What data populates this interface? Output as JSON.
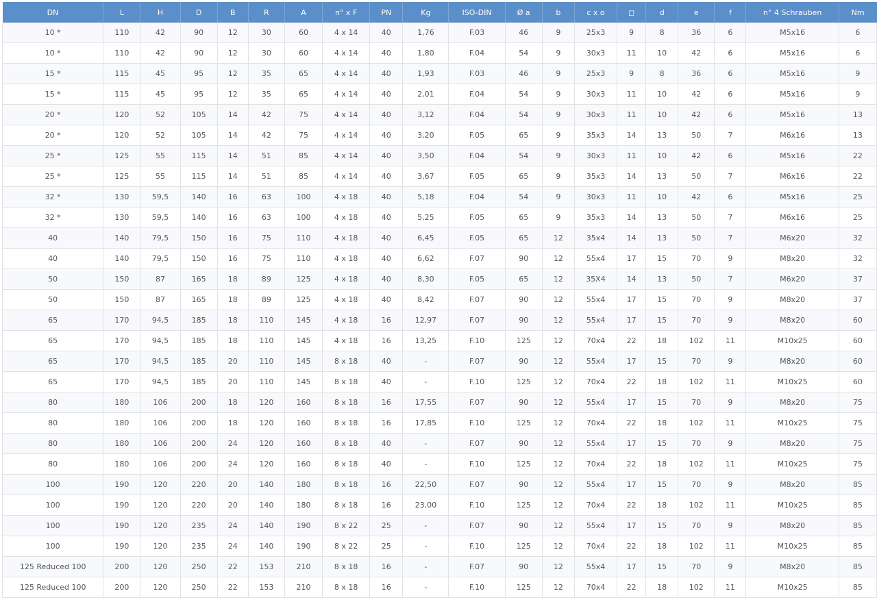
{
  "table": {
    "headers": [
      "DN",
      "L",
      "H",
      "D",
      "B",
      "R",
      "A",
      "n° x F",
      "PN",
      "Kg",
      "ISO-DIN",
      "Ø a",
      "b",
      "c x o",
      "◻",
      "d",
      "e",
      "f",
      "n° 4 Schrauben",
      "Nm"
    ],
    "rows": [
      [
        "10 *",
        "110",
        "42",
        "90",
        "12",
        "30",
        "60",
        "4 x 14",
        "40",
        "1,76",
        "F.03",
        "46",
        "9",
        "25x3",
        "9",
        "8",
        "36",
        "6",
        "M5x16",
        "6"
      ],
      [
        "10 *",
        "110",
        "42",
        "90",
        "12",
        "30",
        "60",
        "4 x 14",
        "40",
        "1,80",
        "F.04",
        "54",
        "9",
        "30x3",
        "11",
        "10",
        "42",
        "6",
        "M5x16",
        "6"
      ],
      [
        "15 *",
        "115",
        "45",
        "95",
        "12",
        "35",
        "65",
        "4 x 14",
        "40",
        "1,93",
        "F.03",
        "46",
        "9",
        "25x3",
        "9",
        "8",
        "36",
        "6",
        "M5x16",
        "9"
      ],
      [
        "15 *",
        "115",
        "45",
        "95",
        "12",
        "35",
        "65",
        "4 x 14",
        "40",
        "2,01",
        "F.04",
        "54",
        "9",
        "30x3",
        "11",
        "10",
        "42",
        "6",
        "M5x16",
        "9"
      ],
      [
        "20 *",
        "120",
        "52",
        "105",
        "14",
        "42",
        "75",
        "4 x 14",
        "40",
        "3,12",
        "F.04",
        "54",
        "9",
        "30x3",
        "11",
        "10",
        "42",
        "6",
        "M5x16",
        "13"
      ],
      [
        "20 *",
        "120",
        "52",
        "105",
        "14",
        "42",
        "75",
        "4 x 14",
        "40",
        "3,20",
        "F.05",
        "65",
        "9",
        "35x3",
        "14",
        "13",
        "50",
        "7",
        "M6x16",
        "13"
      ],
      [
        "25 *",
        "125",
        "55",
        "115",
        "14",
        "51",
        "85",
        "4 x 14",
        "40",
        "3,50",
        "F.04",
        "54",
        "9",
        "30x3",
        "11",
        "10",
        "42",
        "6",
        "M5x16",
        "22"
      ],
      [
        "25 *",
        "125",
        "55",
        "115",
        "14",
        "51",
        "85",
        "4 x 14",
        "40",
        "3,67",
        "F.05",
        "65",
        "9",
        "35x3",
        "14",
        "13",
        "50",
        "7",
        "M6x16",
        "22"
      ],
      [
        "32 *",
        "130",
        "59,5",
        "140",
        "16",
        "63",
        "100",
        "4 x 18",
        "40",
        "5,18",
        "F.04",
        "54",
        "9",
        "30x3",
        "11",
        "10",
        "42",
        "6",
        "M5x16",
        "25"
      ],
      [
        "32 *",
        "130",
        "59,5",
        "140",
        "16",
        "63",
        "100",
        "4 x 18",
        "40",
        "5,25",
        "F.05",
        "65",
        "9",
        "35x3",
        "14",
        "13",
        "50",
        "7",
        "M6x16",
        "25"
      ],
      [
        "40",
        "140",
        "79,5",
        "150",
        "16",
        "75",
        "110",
        "4 x 18",
        "40",
        "6,45",
        "F.05",
        "65",
        "12",
        "35x4",
        "14",
        "13",
        "50",
        "7",
        "M6x20",
        "32"
      ],
      [
        "40",
        "140",
        "79,5",
        "150",
        "16",
        "75",
        "110",
        "4 x 18",
        "40",
        "6,62",
        "F.07",
        "90",
        "12",
        "55x4",
        "17",
        "15",
        "70",
        "9",
        "M8x20",
        "32"
      ],
      [
        "50",
        "150",
        "87",
        "165",
        "18",
        "89",
        "125",
        "4 x 18",
        "40",
        "8,30",
        "F.05",
        "65",
        "12",
        "35X4",
        "14",
        "13",
        "50",
        "7",
        "M6x20",
        "37"
      ],
      [
        "50",
        "150",
        "87",
        "165",
        "18",
        "89",
        "125",
        "4 x 18",
        "40",
        "8,42",
        "F.07",
        "90",
        "12",
        "55x4",
        "17",
        "15",
        "70",
        "9",
        "M8x20",
        "37"
      ],
      [
        "65",
        "170",
        "94,5",
        "185",
        "18",
        "110",
        "145",
        "4 x 18",
        "16",
        "12,97",
        "F.07",
        "90",
        "12",
        "55x4",
        "17",
        "15",
        "70",
        "9",
        "M8x20",
        "60"
      ],
      [
        "65",
        "170",
        "94,5",
        "185",
        "18",
        "110",
        "145",
        "4 x 18",
        "16",
        "13,25",
        "F.10",
        "125",
        "12",
        "70x4",
        "22",
        "18",
        "102",
        "11",
        "M10x25",
        "60"
      ],
      [
        "65",
        "170",
        "94,5",
        "185",
        "20",
        "110",
        "145",
        "8 x 18",
        "40",
        "-",
        "F.07",
        "90",
        "12",
        "55x4",
        "17",
        "15",
        "70",
        "9",
        "M8x20",
        "60"
      ],
      [
        "65",
        "170",
        "94,5",
        "185",
        "20",
        "110",
        "145",
        "8 x 18",
        "40",
        "-",
        "F.10",
        "125",
        "12",
        "70x4",
        "22",
        "18",
        "102",
        "11",
        "M10x25",
        "60"
      ],
      [
        "80",
        "180",
        "106",
        "200",
        "18",
        "120",
        "160",
        "8 x 18",
        "16",
        "17,55",
        "F.07",
        "90",
        "12",
        "55x4",
        "17",
        "15",
        "70",
        "9",
        "M8x20",
        "75"
      ],
      [
        "80",
        "180",
        "106",
        "200",
        "18",
        "120",
        "160",
        "8 x 18",
        "16",
        "17,85",
        "F.10",
        "125",
        "12",
        "70x4",
        "22",
        "18",
        "102",
        "11",
        "M10x25",
        "75"
      ],
      [
        "80",
        "180",
        "106",
        "200",
        "24",
        "120",
        "160",
        "8 x 18",
        "40",
        "-",
        "F.07",
        "90",
        "12",
        "55x4",
        "17",
        "15",
        "70",
        "9",
        "M8x20",
        "75"
      ],
      [
        "80",
        "180",
        "106",
        "200",
        "24",
        "120",
        "160",
        "8 x 18",
        "40",
        "-",
        "F.10",
        "125",
        "12",
        "70x4",
        "22",
        "18",
        "102",
        "11",
        "M10x25",
        "75"
      ],
      [
        "100",
        "190",
        "120",
        "220",
        "20",
        "140",
        "180",
        "8 x 18",
        "16",
        "22,50",
        "F.07",
        "90",
        "12",
        "55x4",
        "17",
        "15",
        "70",
        "9",
        "M8x20",
        "85"
      ],
      [
        "100",
        "190",
        "120",
        "220",
        "20",
        "140",
        "180",
        "8 x 18",
        "16",
        "23,00",
        "F.10",
        "125",
        "12",
        "70x4",
        "22",
        "18",
        "102",
        "11",
        "M10x25",
        "85"
      ],
      [
        "100",
        "190",
        "120",
        "235",
        "24",
        "140",
        "190",
        "8 x 22",
        "25",
        "-",
        "F.07",
        "90",
        "12",
        "55x4",
        "17",
        "15",
        "70",
        "9",
        "M8x20",
        "85"
      ],
      [
        "100",
        "190",
        "120",
        "235",
        "24",
        "140",
        "190",
        "8 x 22",
        "25",
        "-",
        "F.10",
        "125",
        "12",
        "70x4",
        "22",
        "18",
        "102",
        "11",
        "M10x25",
        "85"
      ],
      [
        "125 Reduced 100",
        "200",
        "120",
        "250",
        "22",
        "153",
        "210",
        "8 x 18",
        "16",
        "-",
        "F.07",
        "90",
        "12",
        "55x4",
        "17",
        "15",
        "70",
        "9",
        "M8x20",
        "85"
      ],
      [
        "125 Reduced 100",
        "200",
        "120",
        "250",
        "22",
        "153",
        "210",
        "8 x 18",
        "16",
        "-",
        "F.10",
        "125",
        "12",
        "70x4",
        "22",
        "18",
        "102",
        "11",
        "M10x25",
        "85"
      ]
    ]
  },
  "colors": {
    "header_background": "#5b8fc9",
    "header_text": "#ffffff",
    "row_stripe": "#f7f9fc",
    "border": "#e2e2e2",
    "cell_text": "#555555"
  }
}
